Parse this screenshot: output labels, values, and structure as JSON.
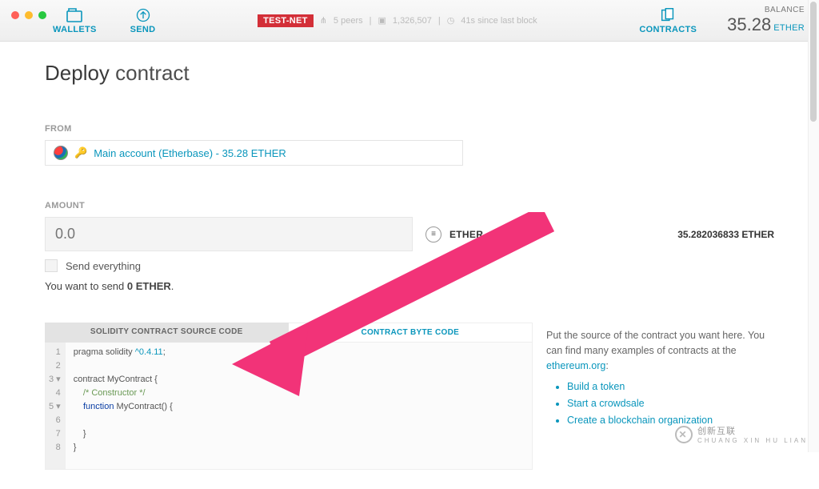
{
  "nav": {
    "wallets": "WALLETS",
    "send": "SEND",
    "contracts": "CONTRACTS",
    "testnet": "TEST-NET",
    "peers": "5 peers",
    "blockNumber": "1,326,507",
    "lastBlock": "41s since last block"
  },
  "balance": {
    "label": "BALANCE",
    "value": "35.28",
    "unit": "ETHER"
  },
  "title": {
    "bold": "Deploy",
    "light": "contract"
  },
  "from": {
    "label": "FROM",
    "accountText": "Main account (Etherbase) - 35.28 ETHER"
  },
  "amount": {
    "label": "AMOUNT",
    "placeholder": "0.0",
    "unit": "ETHER",
    "sendEverything": "Send everything",
    "youWantPrefix": "You want to send ",
    "youWantBold": "0 ETHER",
    "youWantSuffix": ".",
    "available": "35.282036833 ETHER"
  },
  "tabs": {
    "source": "SOLIDITY CONTRACT SOURCE CODE",
    "byte": "CONTRACT BYTE CODE"
  },
  "code": {
    "l1a": "pragma solidity ",
    "l1b": "^0.4.11",
    "l1c": ";",
    "l3": "contract MyContract {",
    "l4": "    /* Constructor */",
    "l5a": "    ",
    "l5b": "function",
    "l5c": " MyContract() {",
    "l7": "    }",
    "l8": "}"
  },
  "info": {
    "p1a": "Put the source of the contract you want here. You can find many examples of contracts at the ",
    "p1link": "ethereum.org",
    "p1b": ":",
    "li1": "Build a token",
    "li2": "Start a crowdsale",
    "li3": "Create a blockchain organization"
  },
  "watermark": "创新互联"
}
